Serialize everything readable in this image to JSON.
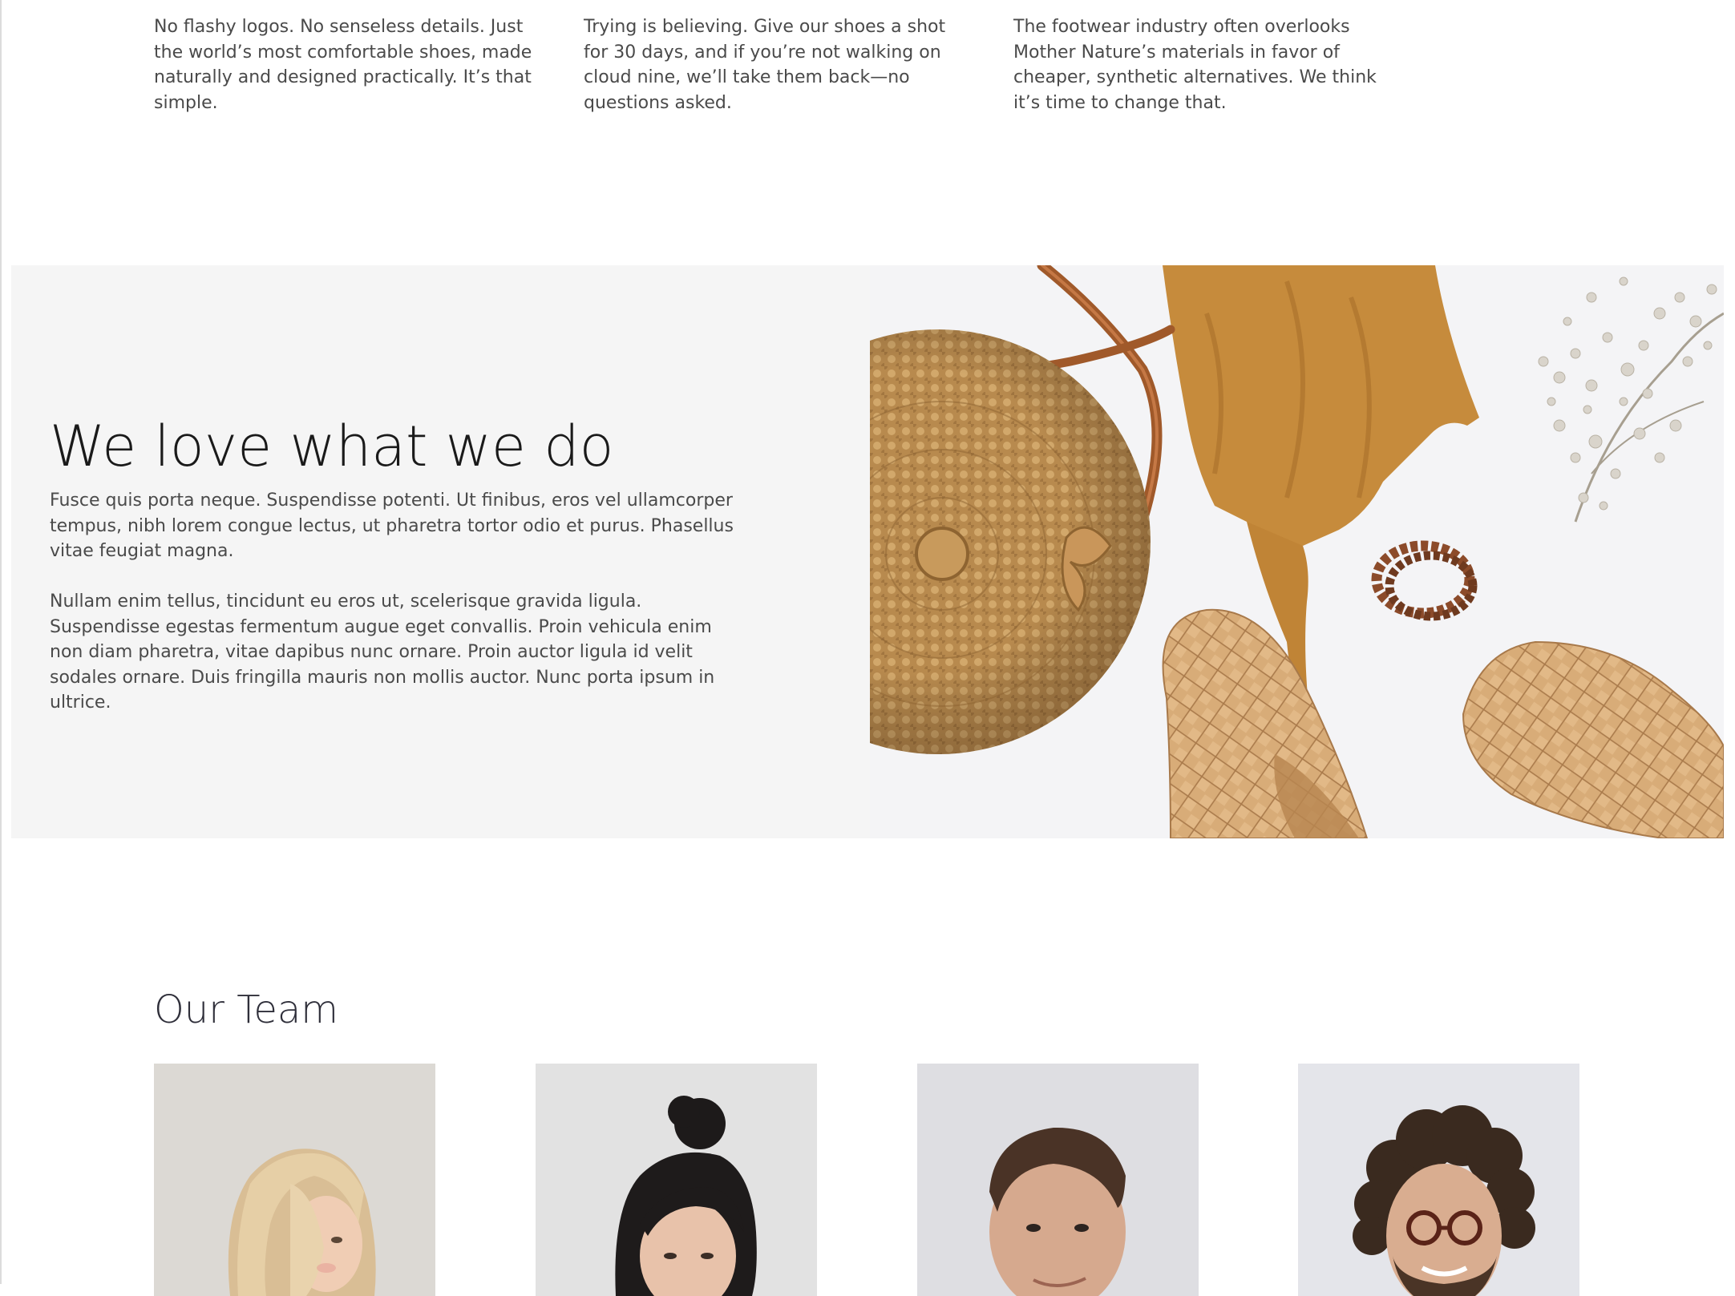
{
  "features": [
    {
      "text": "No flashy logos. No senseless details. Just the world’s most comfortable shoes, made naturally and designed practically. It’s that simple."
    },
    {
      "text": "Trying is believing. Give our shoes a shot for 30 days, and if you’re not walking on cloud nine, we’ll take them back—no questions asked."
    },
    {
      "text": "The footwear industry often overlooks Mother Nature’s materials in favor of cheaper, synthetic alternatives. We think it’s time to change that."
    }
  ],
  "mission": {
    "title": "We love what we do",
    "paragraphs": [
      "Fusce quis porta neque. Suspendisse potenti. Ut finibus, eros vel ullamcorper tempus, nibh lorem congue lectus, ut pharetra tortor odio et purus. Phasellus vitae feugiat magna.",
      "Nullam enim tellus, tincidunt eu eros ut, scelerisque gravida ligula. Suspendisse egestas fermentum augue eget convallis. Proin vehicula enim non diam pharetra, vitae dapibus nunc ornare. Proin auctor ligula id velit sodales ornare. Duis fringilla mauris non mollis auctor. Nunc porta ipsum in ultrice."
    ]
  },
  "team": {
    "title": "Our Team"
  },
  "colors": {
    "text": "#4a4a4a",
    "heading": "#1a1a1a",
    "panel": "#f5f5f5",
    "tan": "#c9a376",
    "mustard": "#c68b3c"
  }
}
